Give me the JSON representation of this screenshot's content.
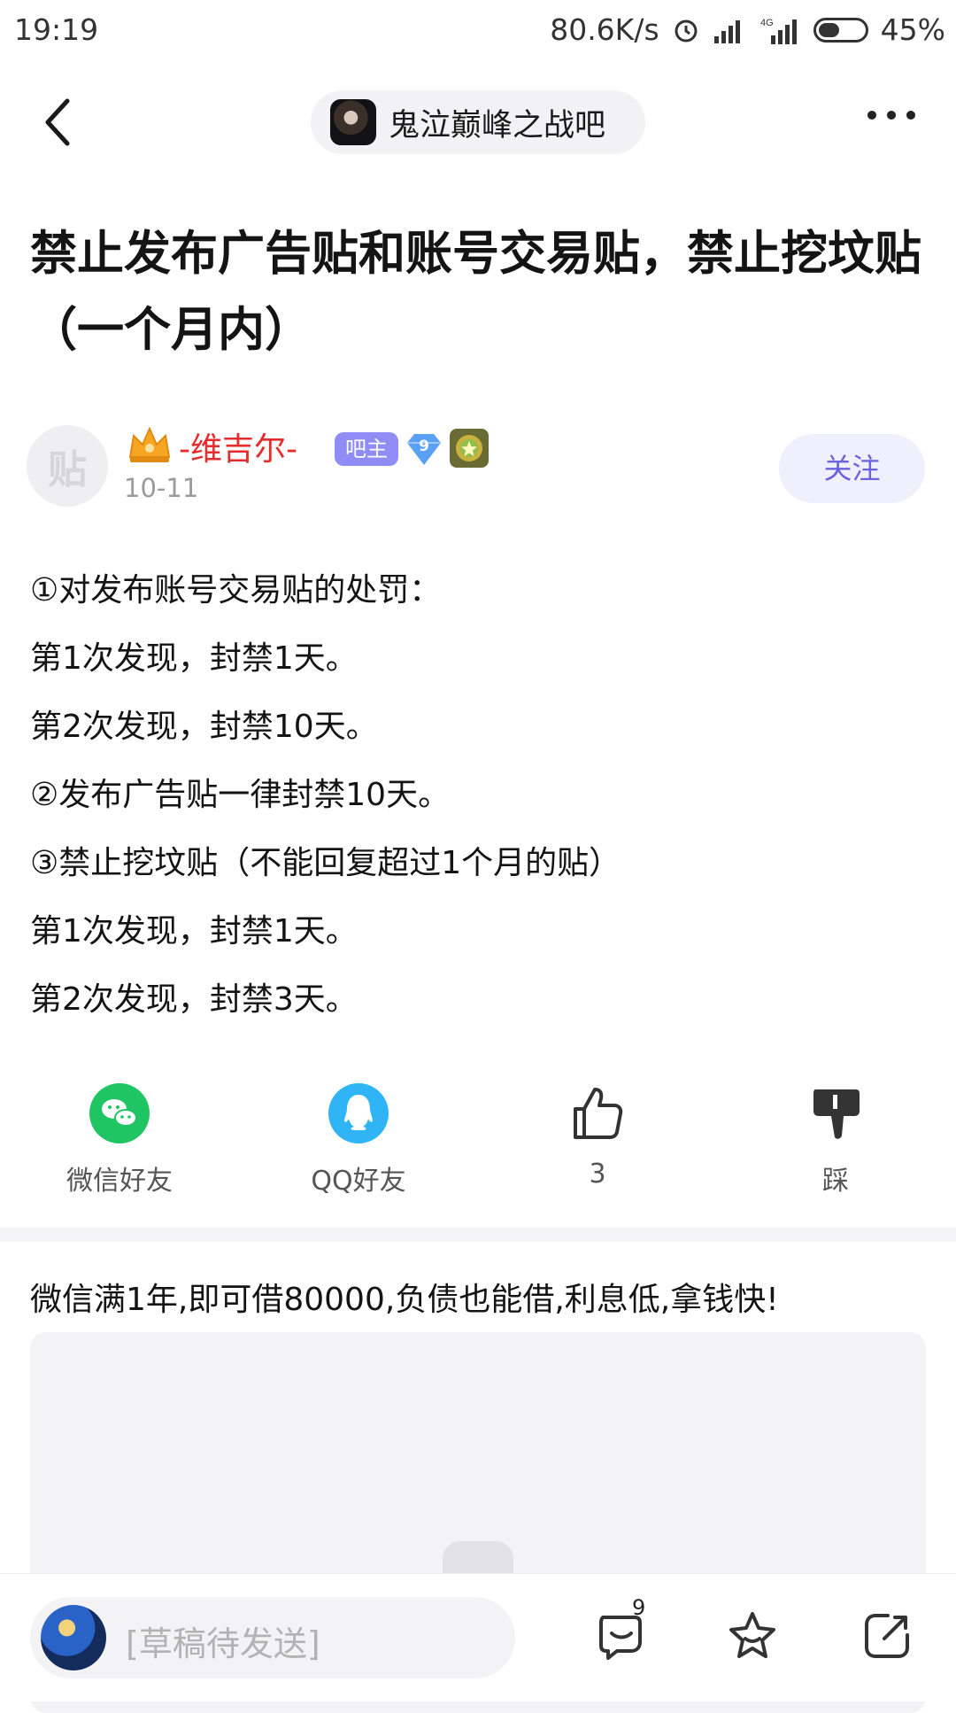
{
  "status_bar": {
    "time": "19:19",
    "network_speed": "80.6K/s",
    "network_type": "4G",
    "battery": "45%",
    "battery_level": 0.45,
    "icons": [
      "alarm-icon",
      "signal-icon",
      "signal-4g-icon",
      "battery-icon"
    ]
  },
  "nav": {
    "forum_name": "鬼泣巅峰之战吧",
    "back_icon": "chevron-left-icon",
    "more_icon": "more-dots-icon"
  },
  "post": {
    "title": "禁止发布广告贴和账号交易贴，禁止挖坟贴（一个月内）",
    "author": {
      "avatar_placeholder": "贴",
      "name": "-维吉尔-",
      "role_badge": "吧主",
      "level": "9",
      "date": "10-11",
      "name_color": "#e52c2c"
    },
    "follow_label": "关注",
    "body_lines": [
      "①对发布账号交易贴的处罚：",
      "第1次发现，封禁1天。",
      "第2次发现，封禁10天。",
      "②发布广告贴一律封禁10天。",
      "③禁止挖坟贴（不能回复超过1个月的贴）",
      "第1次发现，封禁1天。",
      "第2次发现，封禁3天。"
    ]
  },
  "actions": [
    {
      "label": "微信好友",
      "icon": "wechat-icon",
      "color": "#1fc563"
    },
    {
      "label": "QQ好友",
      "icon": "qq-icon",
      "color": "#2fb4f6"
    },
    {
      "label": "3",
      "icon": "thumbs-up-icon"
    },
    {
      "label": "踩",
      "icon": "thumbs-down-icon"
    }
  ],
  "ad": {
    "text": "微信满1年,即可借80000,负债也能借,利息低,拿钱快!"
  },
  "bottom_bar": {
    "reply_placeholder": "[草稿待发送]",
    "comment_count": "9",
    "icons": [
      "comment-icon",
      "star-icon",
      "share-icon"
    ]
  },
  "colors": {
    "accent": "#6b63de",
    "badge": "#8f8cf5"
  }
}
